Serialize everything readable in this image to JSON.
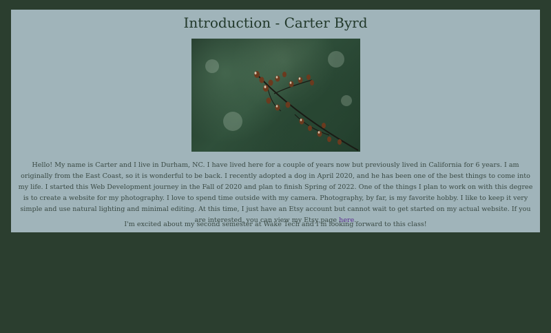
{
  "page": {
    "title": "Introduction - Carter Byrd",
    "bio_text": "Hello! My name is Carter and I live in Durham, NC. I have lived here for a couple of years now but previously lived in California for 6 years. I am originally from the East Coast, so it is wonderful to be back. I recently adopted a dog in April 2020, and he has been one of the best things to come into my life. I started this Web Development journey in the Fall of 2020 and plan to finish Spring of 2022. One of the things I plan to work on with this degree is to create a website for my photography. I love to spend time outside with my camera. Photography, by far, is my favorite hobby. I like to keep it very simple and use natural lighting and minimal editing. At this time, I just have an Etsy account but cannot wait to get started on my actual website. If you are interested, you can view my Etsy page ",
    "etsy_link_text": "here",
    "bio_end": ".",
    "closing_text": "I'm excited about my second semester at Wake Tech and I'm looking forward to this class!"
  },
  "colors": {
    "background": "#2b3e2f",
    "card": "#a0b4ba",
    "title": "#22392b",
    "text": "#3a4a44",
    "link": "#5a2d91"
  }
}
